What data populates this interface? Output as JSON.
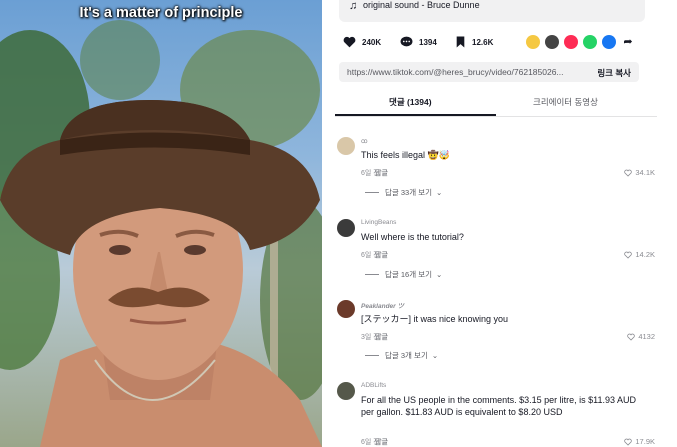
{
  "video": {
    "caption": "It's a matter of principle"
  },
  "sound": {
    "label": "original sound - Bruce Dunne"
  },
  "stats": {
    "likes": "240K",
    "comments": "1394",
    "saves": "12.6K"
  },
  "share_icons": [
    "embed-icon",
    "code-icon",
    "send-icon",
    "whatsapp-icon",
    "facebook-icon",
    "share-arrow-icon"
  ],
  "link": {
    "url": "https://www.tiktok.com/@heres_brucy/video/762185026...",
    "copy_label": "링크 복사"
  },
  "tabs": [
    {
      "label": "댓글 (1394)",
      "active": true
    },
    {
      "label": "크리에이터 동영상",
      "active": false
    }
  ],
  "comments": [
    {
      "user": "ꝏ",
      "text": "This feels illegal 🤠🤯",
      "date": "6일 전",
      "reply_label": "답글",
      "likes": "34.1K",
      "more": "답글 33개 보기"
    },
    {
      "user": "LivingBeans",
      "text": "Well where is the tutorial?",
      "date": "6일 전",
      "reply_label": "답글",
      "likes": "14.2K",
      "more": "답글 16개 보기"
    },
    {
      "user": "Peaklander ツ",
      "text": "[ステッカー] it was nice knowing you",
      "date": "3일 전",
      "reply_label": "답글",
      "likes": "4132",
      "more": "답글 3개 보기"
    },
    {
      "user": "ADBLifts",
      "text": "For all the US people in the comments. $3.15 per litre, is $11.93 AUD per gallon. $11.83 AUD is equivalent to $8.20 USD",
      "date": "6일 전",
      "reply_label": "답글",
      "likes": "17.9K",
      "more": ""
    }
  ],
  "colors": {
    "text_primary": "#161823",
    "text_secondary": "#8a8b91",
    "panel_bg": "#ffffff",
    "box_bg": "#f1f1f2"
  }
}
